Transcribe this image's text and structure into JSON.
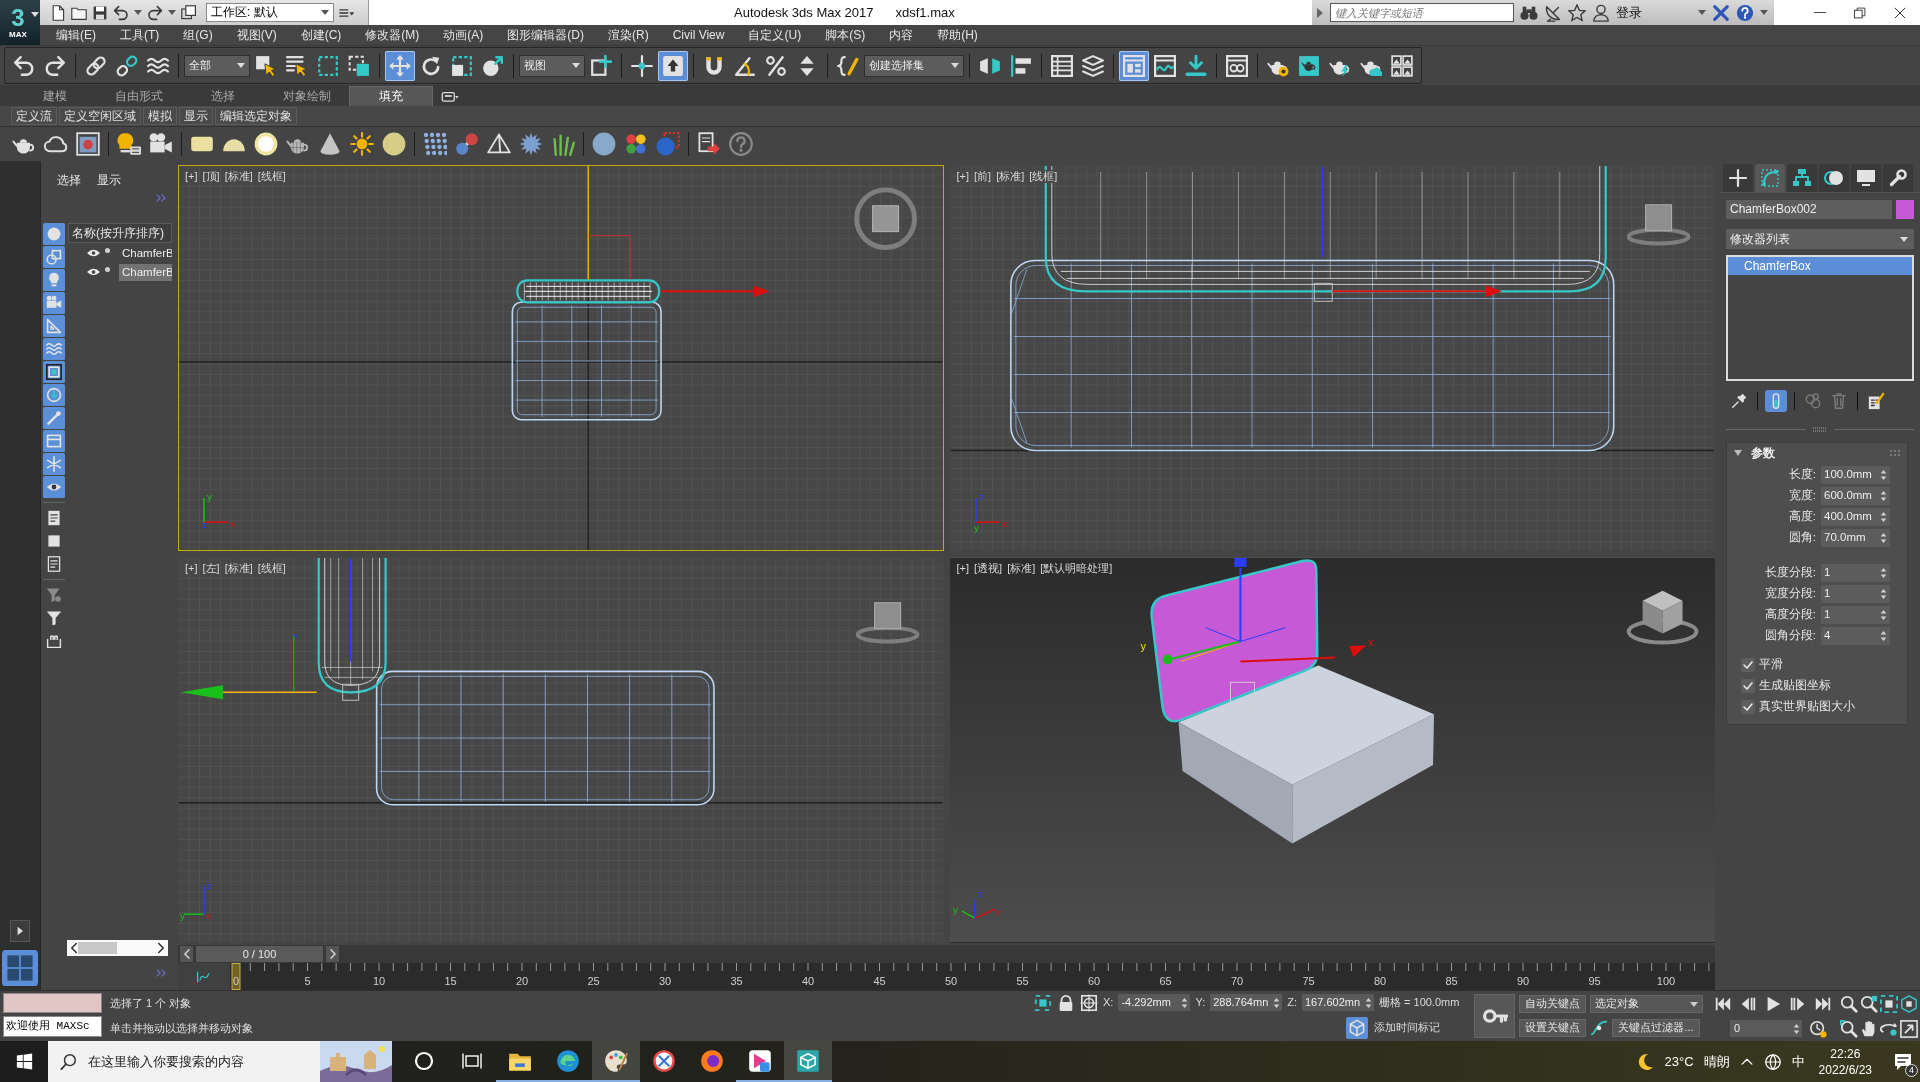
{
  "title_bar": {
    "logo": {
      "digit": "3",
      "label": "MAX"
    },
    "workspace": "工作区: 默认",
    "title": "Autodesk 3ds Max 2017",
    "file_name": "xdsf1.max",
    "search": {
      "placeholder": "键入关键字或短语"
    },
    "sign_in": "登录"
  },
  "menu": [
    "编辑(E)",
    "工具(T)",
    "组(G)",
    "视图(V)",
    "创建(C)",
    "修改器(M)",
    "动画(A)",
    "图形编辑器(D)",
    "渲染(R)",
    "Civil View",
    "自定义(U)",
    "脚本(S)",
    "内容",
    "帮助(H)"
  ],
  "main_toolbar": [
    [
      {
        "kind": "undo",
        "selected": false
      },
      {
        "kind": "redo",
        "selected": false
      }
    ],
    [
      {
        "kind": "link",
        "selected": false
      },
      {
        "kind": "unlink",
        "selected": false
      },
      {
        "kind": "bind",
        "selected": false
      }
    ],
    [
      {
        "kind": "dropdown",
        "value": "全部"
      },
      {
        "kind": "select",
        "selected": false
      },
      {
        "kind": "select-name",
        "selected": false
      },
      {
        "kind": "region",
        "selected": false
      },
      {
        "kind": "crossing",
        "selected": false
      }
    ],
    [
      {
        "kind": "move",
        "selected": true
      },
      {
        "kind": "rotate",
        "selected": false
      },
      {
        "kind": "scale",
        "selected": false
      },
      {
        "kind": "place",
        "selected": false
      }
    ],
    [
      {
        "kind": "dropdown",
        "value": "视图"
      },
      {
        "kind": "pivot",
        "selected": false
      }
    ],
    [
      {
        "kind": "manipulate",
        "selected": false
      },
      {
        "kind": "keyboard",
        "selected": true
      }
    ],
    [
      {
        "kind": "snap",
        "selected": false
      },
      {
        "kind": "angle-snap",
        "selected": false
      },
      {
        "kind": "percent-snap",
        "selected": false
      },
      {
        "kind": "spinner-snap",
        "selected": false
      }
    ],
    [
      {
        "kind": "named-sets",
        "selected": false
      },
      {
        "kind": "dropdown",
        "value": "创建选择集"
      }
    ],
    [
      {
        "kind": "mirror",
        "selected": false
      },
      {
        "kind": "align",
        "selected": false
      }
    ],
    [
      {
        "kind": "scene-explorer",
        "selected": false
      },
      {
        "kind": "layers",
        "selected": false
      }
    ],
    [
      {
        "kind": "ribbon",
        "selected": true
      },
      {
        "kind": "curves",
        "selected": false
      },
      {
        "kind": "schematic",
        "selected": false
      }
    ],
    [
      {
        "kind": "material",
        "selected": false
      }
    ],
    [
      {
        "kind": "render-setup",
        "selected": false
      },
      {
        "kind": "frame-window",
        "selected": false
      },
      {
        "kind": "render",
        "selected": false
      },
      {
        "kind": "cloud-render",
        "selected": false
      },
      {
        "kind": "gallery",
        "selected": false
      }
    ]
  ],
  "ribbon": {
    "tabs": [
      {
        "label": "建模",
        "selected": false
      },
      {
        "label": "自由形式",
        "selected": false
      },
      {
        "label": "选择",
        "selected": false
      },
      {
        "label": "对象绘制",
        "selected": false
      },
      {
        "label": "填充",
        "selected": true
      }
    ],
    "panels": [
      "定义流",
      "定义空闲区域",
      "模拟",
      "显示",
      "编辑选定对象"
    ]
  },
  "scene_explorer": {
    "tabs": [
      "选择",
      "显示"
    ],
    "filters": [
      {
        "kind": "geometry",
        "on": true
      },
      {
        "kind": "shapes",
        "on": true
      },
      {
        "kind": "lights",
        "on": true
      },
      {
        "kind": "cameras",
        "on": true
      },
      {
        "kind": "helpers",
        "on": true
      },
      {
        "kind": "spacewarps",
        "on": true
      },
      {
        "kind": "groups",
        "on": true
      },
      {
        "kind": "xrefs",
        "on": true
      },
      {
        "kind": "bones",
        "on": true
      },
      {
        "kind": "containers",
        "on": true
      },
      {
        "kind": "frozen",
        "on": true
      },
      {
        "kind": "hidden",
        "on": true
      },
      {
        "kind": "all",
        "on": false
      },
      {
        "kind": "none",
        "on": false
      },
      {
        "kind": "invert",
        "on": false
      },
      {
        "kind": "filter-set",
        "on": false
      },
      {
        "kind": "filter",
        "on": false
      },
      {
        "kind": "bracket",
        "on": false
      }
    ],
    "column": "名称(按升序排序)",
    "rows": [
      {
        "name": "ChamferB",
        "visible": true,
        "selected": false
      },
      {
        "name": "ChamferB",
        "visible": true,
        "selected": true
      }
    ]
  },
  "viewports": [
    {
      "kind": "top",
      "active": true,
      "labels": [
        "[+]",
        "[顶]",
        "[标准]",
        "[线框]"
      ],
      "tripod_labels": [
        "y",
        "z",
        "x"
      ]
    },
    {
      "kind": "front",
      "active": false,
      "labels": [
        "[+]",
        "[前]",
        "[标准]",
        "[线框]"
      ],
      "tripod_labels": [
        "z",
        "y",
        "x"
      ]
    },
    {
      "kind": "left",
      "active": false,
      "labels": [
        "[+]",
        "[左]",
        "[标准]",
        "[线框]"
      ],
      "tripod_labels": [
        "z",
        "y",
        "x"
      ]
    },
    {
      "kind": "perspective",
      "active": false,
      "labels": [
        "[+]",
        "[透视]",
        "[标准]",
        "[默认明暗处理]"
      ],
      "axis_labels": [
        "y",
        "x"
      ],
      "tripod_labels": [
        "z",
        "y",
        "x"
      ]
    }
  ],
  "command_panel": {
    "tabs": [
      {
        "kind": "create",
        "selected": false
      },
      {
        "kind": "modify",
        "selected": true
      },
      {
        "kind": "hierarchy",
        "selected": false
      },
      {
        "kind": "motion",
        "selected": false
      },
      {
        "kind": "display",
        "selected": false
      },
      {
        "kind": "utilities",
        "selected": false
      }
    ],
    "object_name": "ChamferBox002",
    "color": "#c65ad6",
    "modifier_list": "修改器列表",
    "stack": [
      {
        "label": "ChamferBox",
        "selected": true
      }
    ],
    "stack_tools": [
      {
        "kind": "pin",
        "selected": false,
        "disabled": false
      },
      {
        "kind": "end-result",
        "selected": true,
        "disabled": false
      },
      {
        "kind": "make-unique",
        "selected": false,
        "disabled": true
      },
      {
        "kind": "remove",
        "selected": false,
        "disabled": true
      },
      {
        "kind": "configure",
        "selected": false,
        "disabled": false
      }
    ],
    "rollout": {
      "title": "参数",
      "expanded": true,
      "groups": [
        [
          {
            "label": "长度:",
            "value": "100.0mm"
          },
          {
            "label": "宽度:",
            "value": "600.0mm"
          },
          {
            "label": "高度:",
            "value": "400.0mm"
          },
          {
            "label": "圆角:",
            "value": "70.0mm"
          }
        ],
        [
          {
            "label": "长度分段:",
            "value": "1"
          },
          {
            "label": "宽度分段:",
            "value": "1"
          },
          {
            "label": "高度分段:",
            "value": "1"
          },
          {
            "label": "圆角分段:",
            "value": "4"
          }
        ]
      ],
      "checkboxes": [
        {
          "label": "平滑",
          "checked": true
        },
        {
          "label": "生成贴图坐标",
          "checked": true
        },
        {
          "label": "真实世界贴图大小",
          "checked": true
        }
      ]
    }
  },
  "timeline": {
    "slider": "0 / 100",
    "level": 0,
    "ticks": [
      "0",
      "5",
      "10",
      "15",
      "20",
      "25",
      "30",
      "35",
      "40",
      "45",
      "50",
      "55",
      "60",
      "65",
      "70",
      "75",
      "80",
      "85",
      "90",
      "95",
      "100"
    ]
  },
  "status": {
    "maxscript_output": "欢迎使用 MAXSc",
    "prompts": [
      "选择了 1 个 对象",
      "单击并拖动以选择并移动对象"
    ],
    "coords": [
      {
        "axis": "X:",
        "value": "-4.292mm"
      },
      {
        "axis": "Y:",
        "value": "288.764mn"
      },
      {
        "axis": "Z:",
        "value": "167.602mn"
      }
    ],
    "grid": "栅格 = 100.0mm",
    "time_tag": "添加时间标记"
  },
  "animation": {
    "auto_key": "自动关键点",
    "key_mode": "选定对象",
    "set_key": "设置关键点",
    "key_filters": "关键点过滤器...",
    "frame": "0"
  },
  "taskbar": {
    "search": {
      "placeholder": "在这里输入你要搜索的内容"
    },
    "apps": [
      {
        "kind": "folder",
        "running": true,
        "selected": false
      },
      {
        "kind": "edge",
        "running": true,
        "selected": false
      },
      {
        "kind": "paint",
        "running": true,
        "selected": true
      },
      {
        "kind": "snip",
        "running": false,
        "selected": false
      },
      {
        "kind": "firefox",
        "running": false,
        "selected": false
      },
      {
        "kind": "video",
        "running": true,
        "selected": false
      },
      {
        "kind": "max",
        "running": true,
        "selected": true
      }
    ],
    "weather": {
      "temp": "23°C",
      "text": "晴朗"
    },
    "ime": "中",
    "time": "22:26",
    "date": "2022/6/23",
    "notifications": "4"
  }
}
